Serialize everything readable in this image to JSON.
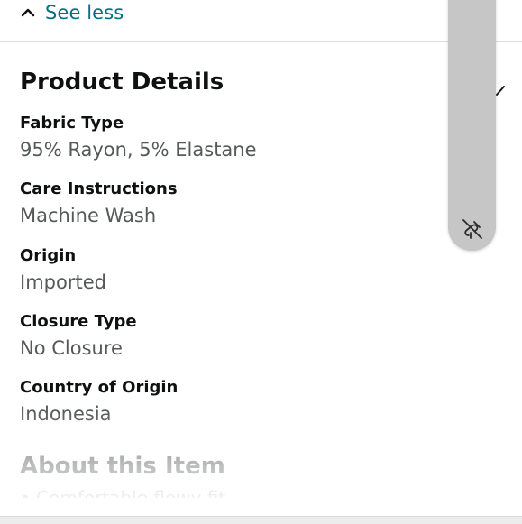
{
  "header": {
    "see_less_label": "See less"
  },
  "product_details": {
    "title": "Product Details",
    "items": [
      {
        "label": "Fabric Type",
        "value": "95% Rayon, 5% Elastane"
      },
      {
        "label": "Care Instructions",
        "value": "Machine Wash"
      },
      {
        "label": "Origin",
        "value": "Imported"
      },
      {
        "label": "Closure Type",
        "value": "No Closure"
      },
      {
        "label": "Country of Origin",
        "value": "Indonesia"
      }
    ]
  },
  "about": {
    "title": "About this Item",
    "first_bullet_partial": "• Comfortable flowy fit"
  },
  "overlay": {
    "icon": "pin-off-icon"
  },
  "colors": {
    "link": "#007185",
    "label": "#0f1111",
    "value": "#565959",
    "handle": "#c6c6c6"
  }
}
